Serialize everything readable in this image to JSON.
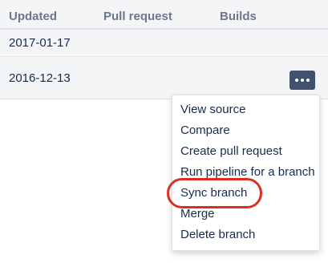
{
  "table": {
    "columns": [
      "Updated",
      "Pull request",
      "Builds"
    ],
    "rows": [
      {
        "updated": "2017-01-17"
      },
      {
        "updated": "2016-12-13"
      }
    ]
  },
  "more_button": {
    "icon": "more-horizontal-icon",
    "color": "#42526e"
  },
  "menu": {
    "items": [
      "View source",
      "Compare",
      "Create pull request",
      "Run pipeline for a branch",
      "Sync branch",
      "Merge",
      "Delete branch"
    ],
    "highlighted_item": "Sync branch",
    "highlight_color": "#d93020"
  }
}
